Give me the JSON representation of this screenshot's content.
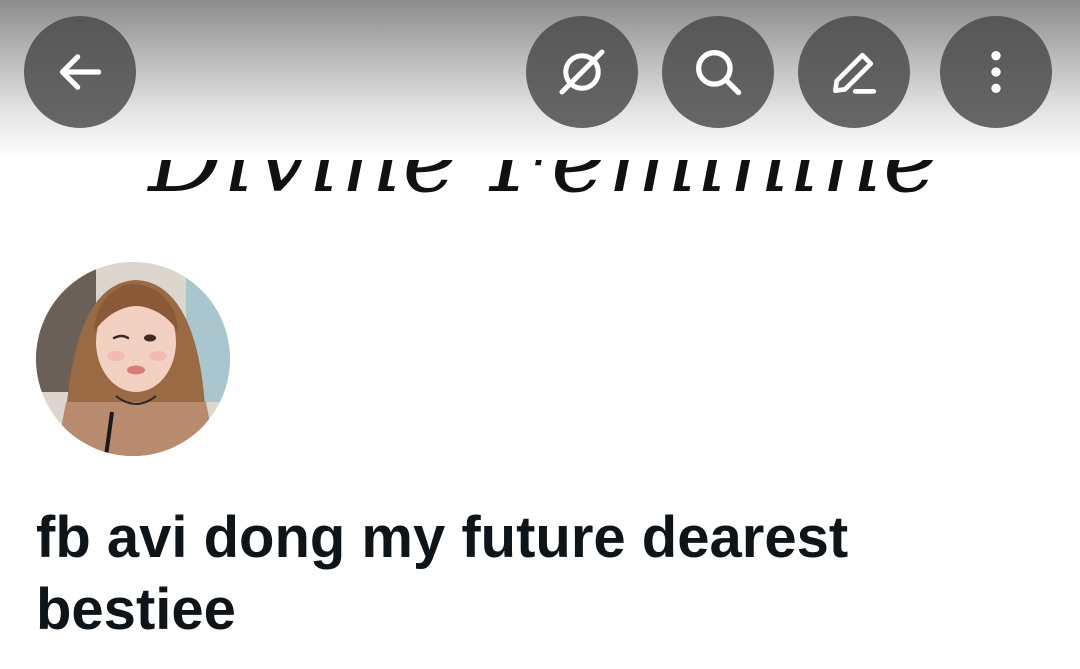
{
  "header": {
    "banner_text": "Divine Feminine",
    "buttons": {
      "back": {
        "icon": "back-arrow-icon"
      },
      "grok": {
        "icon": "grok-icon"
      },
      "search": {
        "icon": "search-icon"
      },
      "edit": {
        "icon": "edit-pencil-icon"
      },
      "more": {
        "icon": "more-vertical-icon"
      }
    }
  },
  "profile": {
    "display_name": "fb avi dong my future dearest bestiee"
  }
}
